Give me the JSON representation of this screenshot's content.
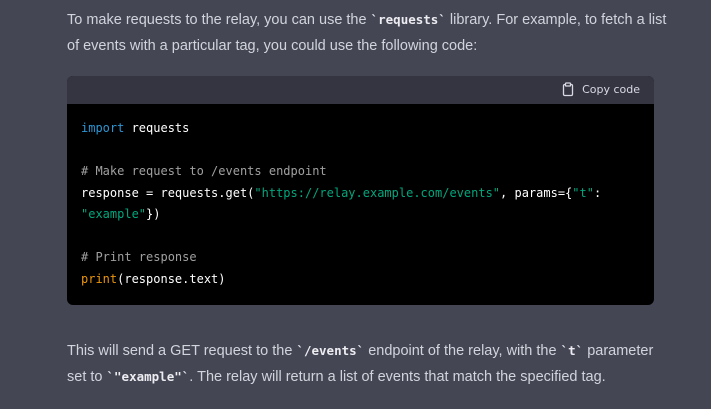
{
  "message_top": {
    "p1": "To make requests to the relay, you can use the ",
    "code1": "`requests`",
    "p2": " library. For example, to fetch a list of events with a particular tag, you could use the following code:"
  },
  "code_block": {
    "copy_label": "Copy code",
    "copy_icon": "clipboard-icon",
    "line1": {
      "keyword": "import",
      "rest": " requests"
    },
    "line3": "# Make request to /events endpoint",
    "line4": {
      "a": "response = requests.get(",
      "url": "\"https://relay.example.com/events\"",
      "b": ", params={",
      "key": "\"t\"",
      "c": ":"
    },
    "line5": {
      "val": "\"example\"",
      "d": "})"
    },
    "line7": "# Print response",
    "line8": {
      "fn": "print",
      "rest": "(response.text)"
    }
  },
  "message_bottom": {
    "p1": "This will send a GET request to the ",
    "code1": "`/events`",
    "p2": " endpoint of the relay, with the ",
    "code2": "`t`",
    "p3": " parameter set to ",
    "code3": "`\"example\"`",
    "p4": ". The relay will return a list of events that match the specified tag."
  },
  "colors": {
    "background": "#444654",
    "code_bg": "#000000",
    "code_header_bg": "#343541",
    "keyword": "#2e95d3",
    "string": "#00a67d",
    "comment": "#a0a0a0",
    "builtin": "#e9950c"
  }
}
